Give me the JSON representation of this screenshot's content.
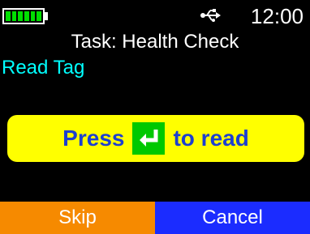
{
  "status": {
    "battery_color": "#00e000",
    "usb_icon": "usb-connection-icon",
    "time": "12:00"
  },
  "header": {
    "title": "Task: Health Check"
  },
  "section": {
    "label": "Read Tag",
    "color": "#00ffff"
  },
  "prompt": {
    "before": "Press",
    "key_icon": "enter-key-icon",
    "after": "to read",
    "background": "#ffff00",
    "text_color": "#1d3fd0",
    "key_color": "#00c800"
  },
  "softkeys": {
    "left_label": "Skip",
    "left_color": "#f68a00",
    "right_label": "Cancel",
    "right_color": "#1b2cff"
  }
}
